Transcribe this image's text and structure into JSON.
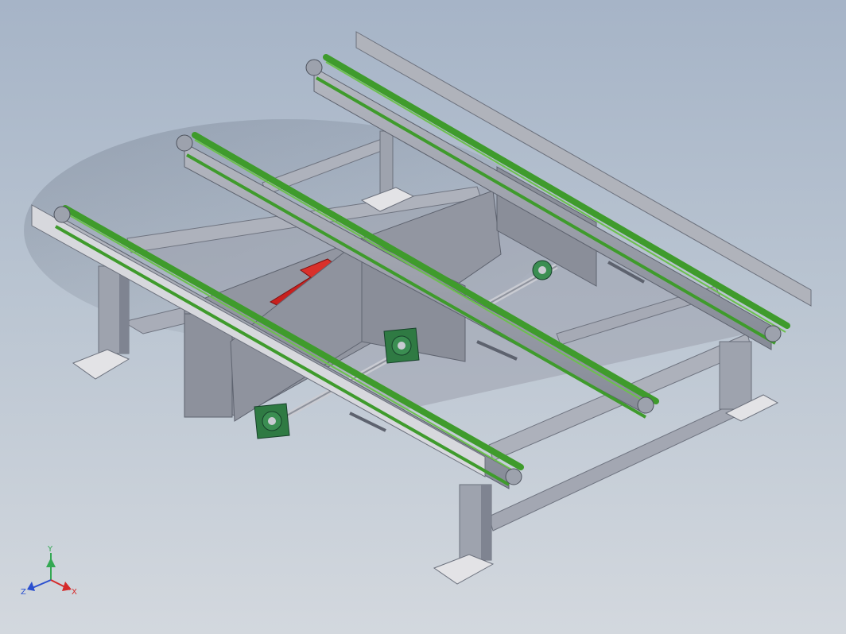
{
  "viewport": {
    "background_top": "#a6b4c7",
    "background_bottom": "#d3d8de"
  },
  "model": {
    "frame_color": "#a7abb6",
    "frame_dark": "#7d8290",
    "plate_color": "#8f939e",
    "belt_color": "#3f9b2c",
    "bearing_color": "#2f7a43",
    "motor_color": "#c8201e",
    "foot_color": "#e3e3e6"
  },
  "triad": {
    "y_label": "Y",
    "z_label": "Z",
    "x_label": "X",
    "y_color": "#34a853",
    "z_color": "#2a4fcf",
    "x_color": "#d52a2a"
  }
}
